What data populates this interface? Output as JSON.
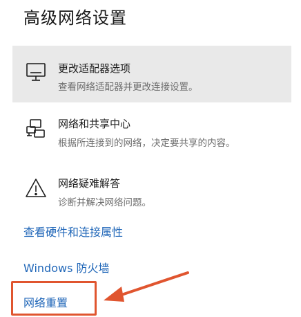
{
  "header": {
    "title": "高级网络设置"
  },
  "items": [
    {
      "title": "更改适配器选项",
      "description": "查看网络适配器并更改连接设置。",
      "icon": "monitor-icon"
    },
    {
      "title": "网络和共享中心",
      "description": "根据所连接到的网络，决定要共享的内容。",
      "icon": "network-sharing-icon"
    },
    {
      "title": "网络疑难解答",
      "description": "诊断并解决网络问题。",
      "icon": "warning-icon"
    }
  ],
  "links": {
    "hardware_properties": "查看硬件和连接属性",
    "firewall": "Windows 防火墙",
    "network_reset": "网络重置"
  },
  "colors": {
    "accent_link": "#1f66b8",
    "selected_bg": "#e9e9e9",
    "annotation": "#e0552f"
  }
}
